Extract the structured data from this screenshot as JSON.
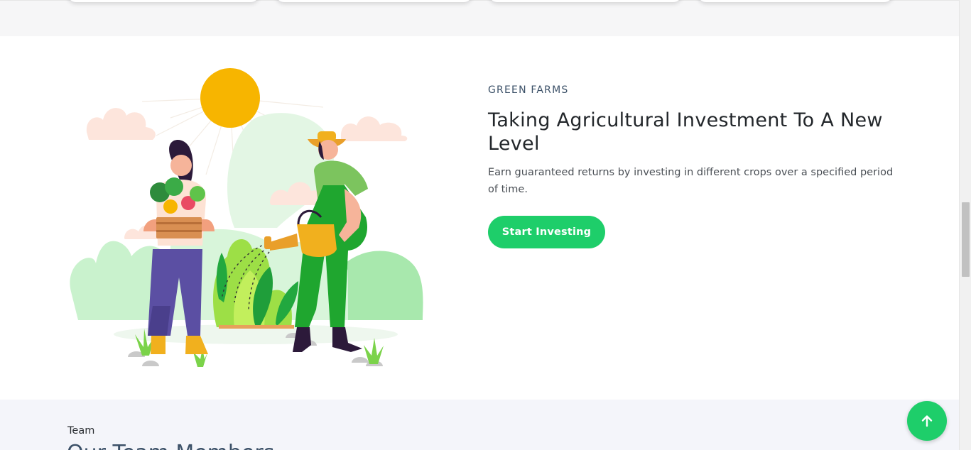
{
  "hero": {
    "eyebrow": "GREEN FARMS",
    "headline": "Taking Agricultural Investment To A New Level",
    "subtext": "Earn guaranteed returns by investing in different crops over a specified period of time.",
    "cta_label": "Start Investing",
    "illustration_icon": "farmers-watering-plants-illustration"
  },
  "team": {
    "eyebrow": "Team",
    "title": "Our Team Members"
  },
  "back_to_top_icon": "arrow-up-icon",
  "colors": {
    "accent": "#1ece6a",
    "heading": "#23272b",
    "eyebrow": "#3c5168"
  }
}
